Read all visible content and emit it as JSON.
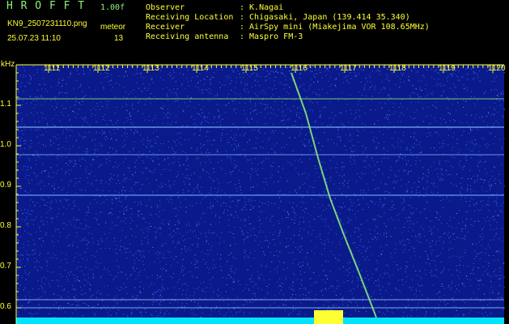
{
  "header": {
    "logo": "H R O F F T",
    "version": "1.00f",
    "filename": "KN9_2507231110.png",
    "meteor_label": "meteor",
    "datetime": "25.07.23 11:10",
    "meteor_count": "13",
    "info": [
      {
        "key": "Observer",
        "value": ": K.Nagai"
      },
      {
        "key": "Receiving Location",
        "value": ": Chigasaki, Japan (139.414 35.340)"
      },
      {
        "key": "Receiver",
        "value": ": AirSpy mini (Miakejima VOR 108.65MHz)"
      },
      {
        "key": "Receiving antenna",
        "value": ": Maspro FM-3"
      }
    ]
  },
  "spectrum": {
    "y_unit": "kHz",
    "x_ticks": [
      "1111",
      "1112",
      "1113",
      "1114",
      "1115",
      "1116",
      "1117",
      "1118",
      "1119",
      "1120"
    ],
    "y_ticks": [
      "1.1",
      "1.0",
      "0.9",
      "0.8",
      "0.7",
      "0.6"
    ],
    "colors": {
      "background": "#0a1a8a",
      "noise": "#3a5cff",
      "trace": "#8ff27a",
      "axis": "#ffff33",
      "floor": "#00e5ff"
    }
  }
}
